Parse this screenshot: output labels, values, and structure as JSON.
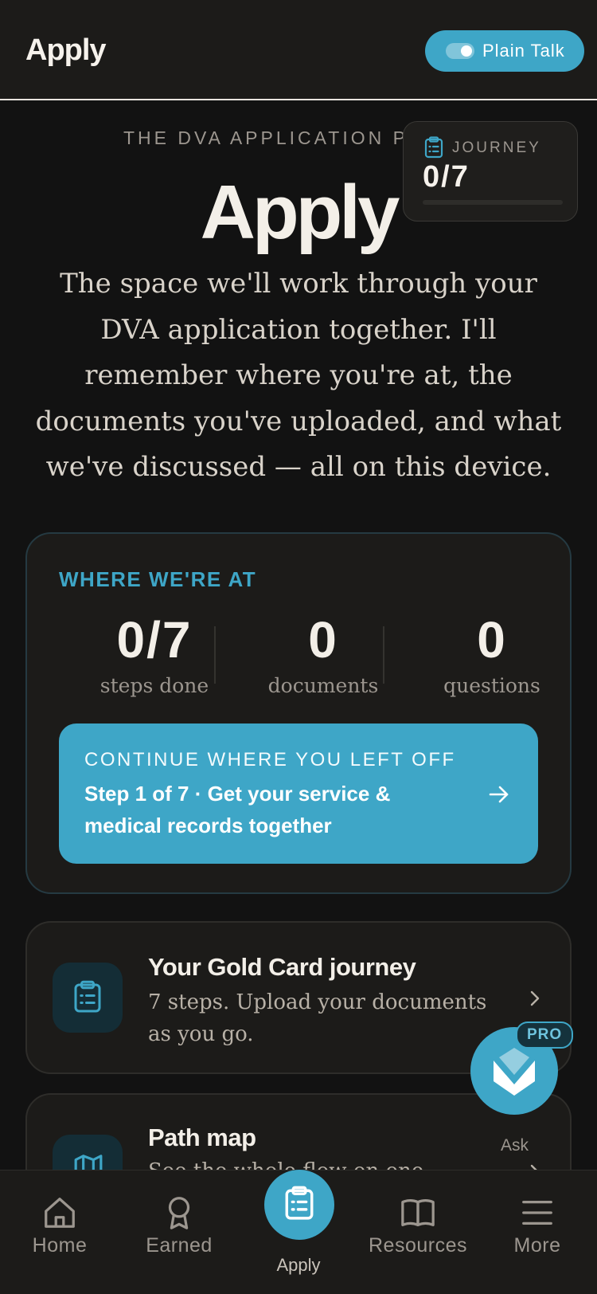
{
  "header": {
    "title": "Apply",
    "toggle_label": "Plain Talk"
  },
  "hero": {
    "eyebrow": "THE DVA APPLICATION PR",
    "title": "Apply",
    "description": "The space we'll work through your DVA application together. I'll remember where you're at, the documents you've uploaded, and what we've discussed — all on this device."
  },
  "journey_widget": {
    "label": "JOURNEY",
    "count": "0/7",
    "progress": 0
  },
  "status": {
    "heading": "WHERE WE'RE AT",
    "stats": [
      {
        "value": "0/7",
        "label": "steps done"
      },
      {
        "value": "0",
        "label": "documents"
      },
      {
        "value": "0",
        "label": "questions"
      }
    ],
    "continue": {
      "eyebrow": "CONTINUE WHERE YOU LEFT OFF",
      "text": "Step 1 of 7 · Get your service & medical records together"
    }
  },
  "cards": [
    {
      "title": "Your Gold Card journey",
      "description": "7 steps. Upload your documents as you go."
    },
    {
      "title": "Path map",
      "description": "See the whole flow on one"
    }
  ],
  "assistant": {
    "badge": "PRO",
    "ask_label": "Ask"
  },
  "nav": {
    "items": [
      {
        "label": "Home",
        "icon": "home-icon"
      },
      {
        "label": "Earned",
        "icon": "award-icon"
      },
      {
        "label": "Apply",
        "icon": "clipboard-icon"
      },
      {
        "label": "Resources",
        "icon": "book-icon"
      },
      {
        "label": "More",
        "icon": "menu-icon"
      }
    ]
  },
  "colors": {
    "accent": "#3ea6c7",
    "background": "#121212",
    "surface": "#1c1b19"
  }
}
